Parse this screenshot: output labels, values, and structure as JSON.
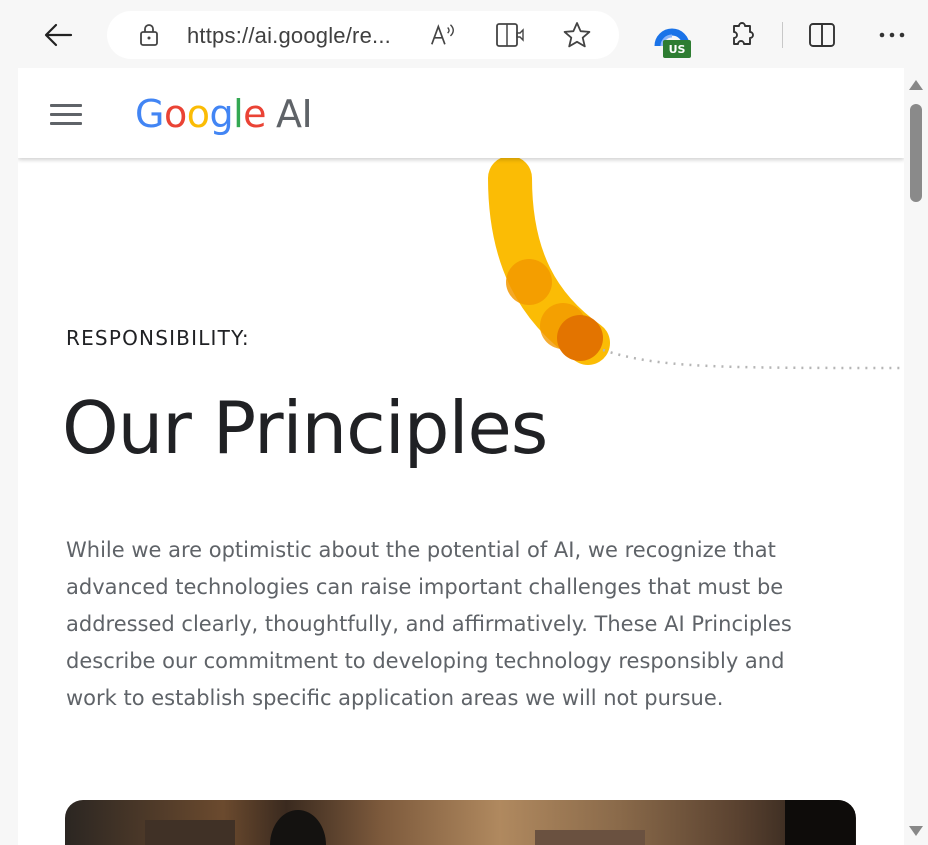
{
  "browser": {
    "url": "https://ai.google/re...",
    "extension_badge": "US"
  },
  "site": {
    "logo": {
      "letters": [
        "G",
        "o",
        "o",
        "g",
        "l",
        "e"
      ],
      "suffix": "AI"
    }
  },
  "content": {
    "eyebrow": "RESPONSIBILITY:",
    "title": "Our Principles",
    "body": "While we are optimistic about the potential of AI, we recognize that advanced technologies can raise important challenges that must be addressed clearly, thoughtfully, and affirmatively.  These AI Principles describe our commitment to developing technology responsibly and work to establish specific application areas we will not pursue."
  },
  "colors": {
    "google_blue": "#4285F4",
    "google_red": "#EA4335",
    "google_yellow": "#FBBC05",
    "google_green": "#34A853",
    "accent_orange": "#E8830C"
  },
  "icons": [
    "back-arrow-icon",
    "lock-icon",
    "read-aloud-icon",
    "immersive-reader-icon",
    "favorite-star-icon",
    "extension-icon",
    "puzzle-extensions-icon",
    "split-screen-icon",
    "more-options-icon",
    "hamburger-menu-icon"
  ]
}
